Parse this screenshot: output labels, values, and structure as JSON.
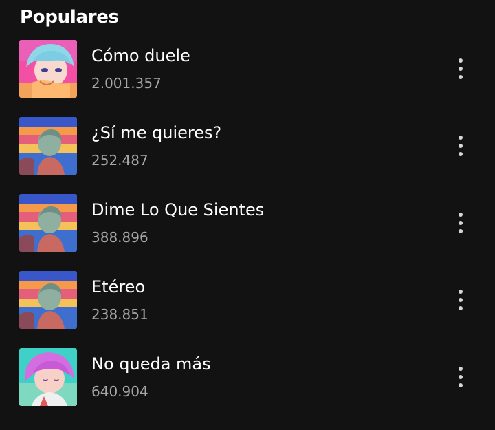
{
  "section": {
    "title": "Populares"
  },
  "tracks": [
    {
      "title": "Cómo duele",
      "plays": "2.001.357",
      "cover_icon": "album-cover-blue-hair-pink"
    },
    {
      "title": "¿Sí me quieres?",
      "plays": "252.487",
      "cover_icon": "album-cover-sunset-clouds"
    },
    {
      "title": "Dime Lo Que Sientes",
      "plays": "388.896",
      "cover_icon": "album-cover-sunset-clouds"
    },
    {
      "title": "Etéreo",
      "plays": "238.851",
      "cover_icon": "album-cover-sunset-clouds"
    },
    {
      "title": "No queda más",
      "plays": "640.904",
      "cover_icon": "album-cover-pink-hair-teal"
    }
  ],
  "menu_icon": "more-vertical-icon",
  "colors": {
    "background": "#121212",
    "primary_text": "#ffffff",
    "secondary_text": "#a7a7a7",
    "icon": "#d6d6d6"
  }
}
